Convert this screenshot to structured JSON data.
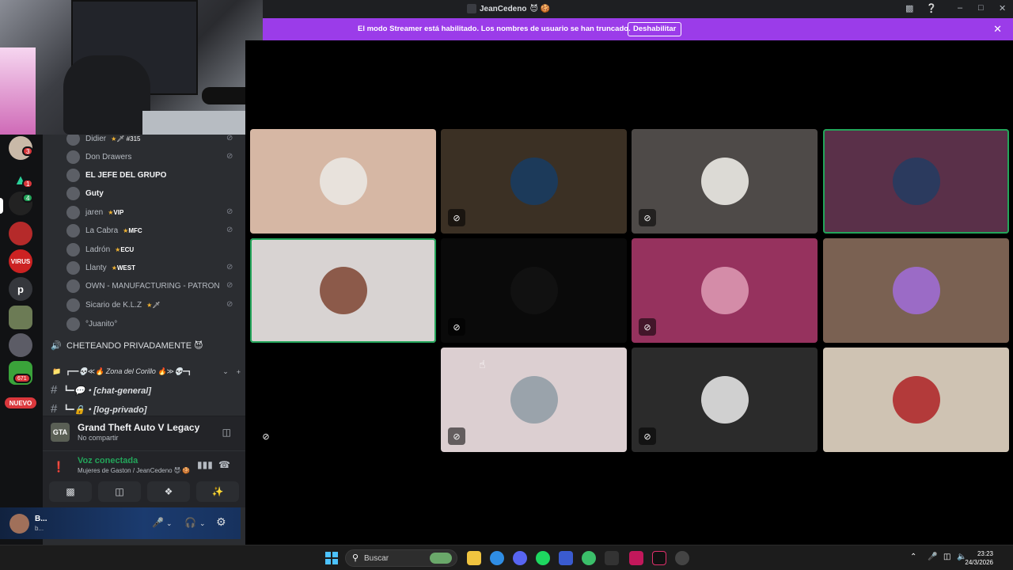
{
  "window": {
    "title": "JeanCedeno",
    "title_emoji": "😈 🍪"
  },
  "streamer_banner": {
    "message": "El modo Streamer está habilitado. Los nombres de usuario se han truncado.",
    "button": "Deshabilitar"
  },
  "servers": {
    "badges": [
      "3",
      "1",
      "4",
      "671"
    ],
    "letter": "p",
    "virus_label": "VIRUS",
    "new_label": "NUEVO"
  },
  "members": [
    {
      "name": "Didier",
      "suffix": "🗡 #315",
      "muted": true
    },
    {
      "name": "Don Drawers",
      "muted": true
    },
    {
      "name": "EL JEFE DEL GRUPO",
      "bright": true,
      "muted": false
    },
    {
      "name": "Guty",
      "bright": true,
      "muted": false
    },
    {
      "name": "jaren",
      "tag": "VIP",
      "muted": true
    },
    {
      "name": "La Cabra",
      "tag": "MFC",
      "muted": true
    },
    {
      "name": "Ladrón",
      "tag": "ECU",
      "muted": false
    },
    {
      "name": "Llanty",
      "tag": "WEST",
      "muted": true
    },
    {
      "name": "OWN - MANUFACTURING - PATRON",
      "muted": true
    },
    {
      "name": "Sicario de K.L.Z",
      "suffix": "🗡",
      "muted": true
    },
    {
      "name": "°Juanito°",
      "muted": false
    }
  ],
  "voice_channel": "CHETEANDO PRIVADAMENTE 😈",
  "category": {
    "label": "┏━━💀≪🔥 Zona del Corillo 🔥≫💀━┓",
    "add": "+"
  },
  "text_channels": [
    {
      "name": "┗━💬・[chat-general]"
    },
    {
      "name": "┗━🔒・[log-privado]"
    }
  ],
  "activity": {
    "game": "Grand Theft Auto V Legacy",
    "status": "No compartir",
    "game_icon_label": "GTA"
  },
  "voice_connection": {
    "status": "Voz conectada",
    "channel": "Mujeres de Gaston / JeanCedeno 😈 🍪"
  },
  "user": {
    "name": "B...",
    "status": "b..."
  },
  "tiles": [
    {
      "bg": "#d6b7a4",
      "avatar": "#e8e2dc",
      "muted": false,
      "speaking": false
    },
    {
      "bg": "#3b3024",
      "avatar": "#1c3a5a",
      "muted": true,
      "speaking": false
    },
    {
      "bg": "#4e4a48",
      "avatar": "#dcdad5",
      "muted": true,
      "speaking": false
    },
    {
      "bg": "#5a3049",
      "avatar": "#2b3a5e",
      "muted": false,
      "speaking": true
    },
    {
      "bg": "#d8d3d2",
      "avatar": "#8c5a4a",
      "muted": false,
      "speaking": true
    },
    {
      "bg": "#0a0a0a",
      "avatar": "#111111",
      "muted": true,
      "speaking": false
    },
    {
      "bg": "#96325e",
      "avatar": "#d48ca8",
      "muted": true,
      "speaking": false
    },
    {
      "bg": "#7a6152",
      "avatar": "#9b6bc6",
      "muted": false,
      "speaking": false
    },
    {
      "bg": "#000000",
      "avatar": "#000000",
      "muted": true,
      "speaking": false
    },
    {
      "bg": "#dccfd1",
      "avatar": "#9aa3ab",
      "muted": true,
      "speaking": false
    },
    {
      "bg": "#2b2b2b",
      "avatar": "#d0d0d0",
      "muted": true,
      "speaking": false
    },
    {
      "bg": "#cfc3b3",
      "avatar": "#b33a3a",
      "muted": false,
      "speaking": false
    }
  ],
  "taskbar": {
    "search_placeholder": "Buscar",
    "time": "23:23",
    "date": "24/3/2026"
  }
}
